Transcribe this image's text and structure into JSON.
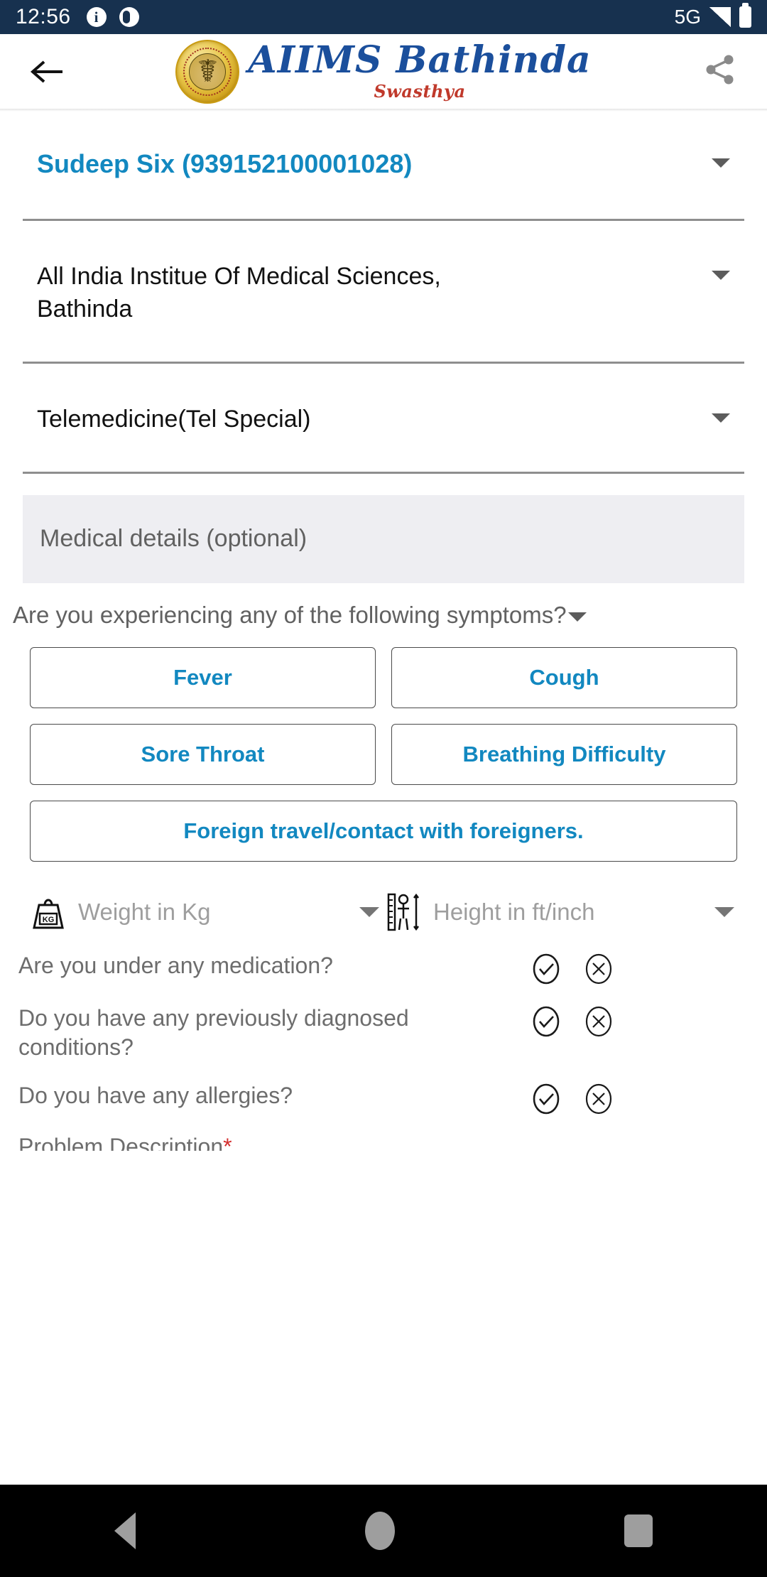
{
  "status_bar": {
    "time": "12:56",
    "info_glyph": "i",
    "network": "5G",
    "icons": [
      "info-icon",
      "app-badge-icon",
      "signal-icon",
      "battery-icon"
    ]
  },
  "app_bar": {
    "back_icon": "back-arrow-icon",
    "logo_emblem": "aiims-emblem-icon",
    "brand_title": "AIIMS Bathinda",
    "brand_subtitle": "Swasthya",
    "share_icon": "share-icon"
  },
  "form": {
    "patient": {
      "label": "patient-select",
      "value": "Sudeep Six (939152100001028)"
    },
    "hospital": {
      "label": "hospital-select",
      "value": "All India Institue Of Medical Sciences, Bathinda"
    },
    "department": {
      "label": "department-select",
      "value": "Telemedicine(Tel Special)"
    },
    "medical_details_banner": "Medical details (optional)",
    "symptoms_question": "Are you experiencing any of the following symptoms?",
    "symptoms": [
      "Fever",
      "Cough",
      "Sore Throat",
      "Breathing Difficulty",
      "Foreign travel/contact with foreigners."
    ],
    "weight": {
      "icon": "weight-kg-icon",
      "placeholder": "Weight in Kg"
    },
    "height": {
      "icon": "height-ruler-icon",
      "placeholder": "Height in ft/inch"
    },
    "questions": [
      "Are you under any medication?",
      "Do you have any previously diagnosed conditions?",
      "Do you have any allergies?"
    ],
    "yes_icon": "check-circle-icon",
    "no_icon": "cross-circle-icon",
    "next_field_label": "Problem Description",
    "next_field_required_mark": "*"
  },
  "nav_bar": {
    "back": "nav-back-icon",
    "home": "nav-home-icon",
    "recents": "nav-recents-icon"
  },
  "colors": {
    "status_bar_bg": "#17314f",
    "accent_blue": "#1288c0",
    "brand_blue": "#1b4f9c",
    "brand_red": "#c0392b",
    "banner_bg": "#eeeef2"
  }
}
